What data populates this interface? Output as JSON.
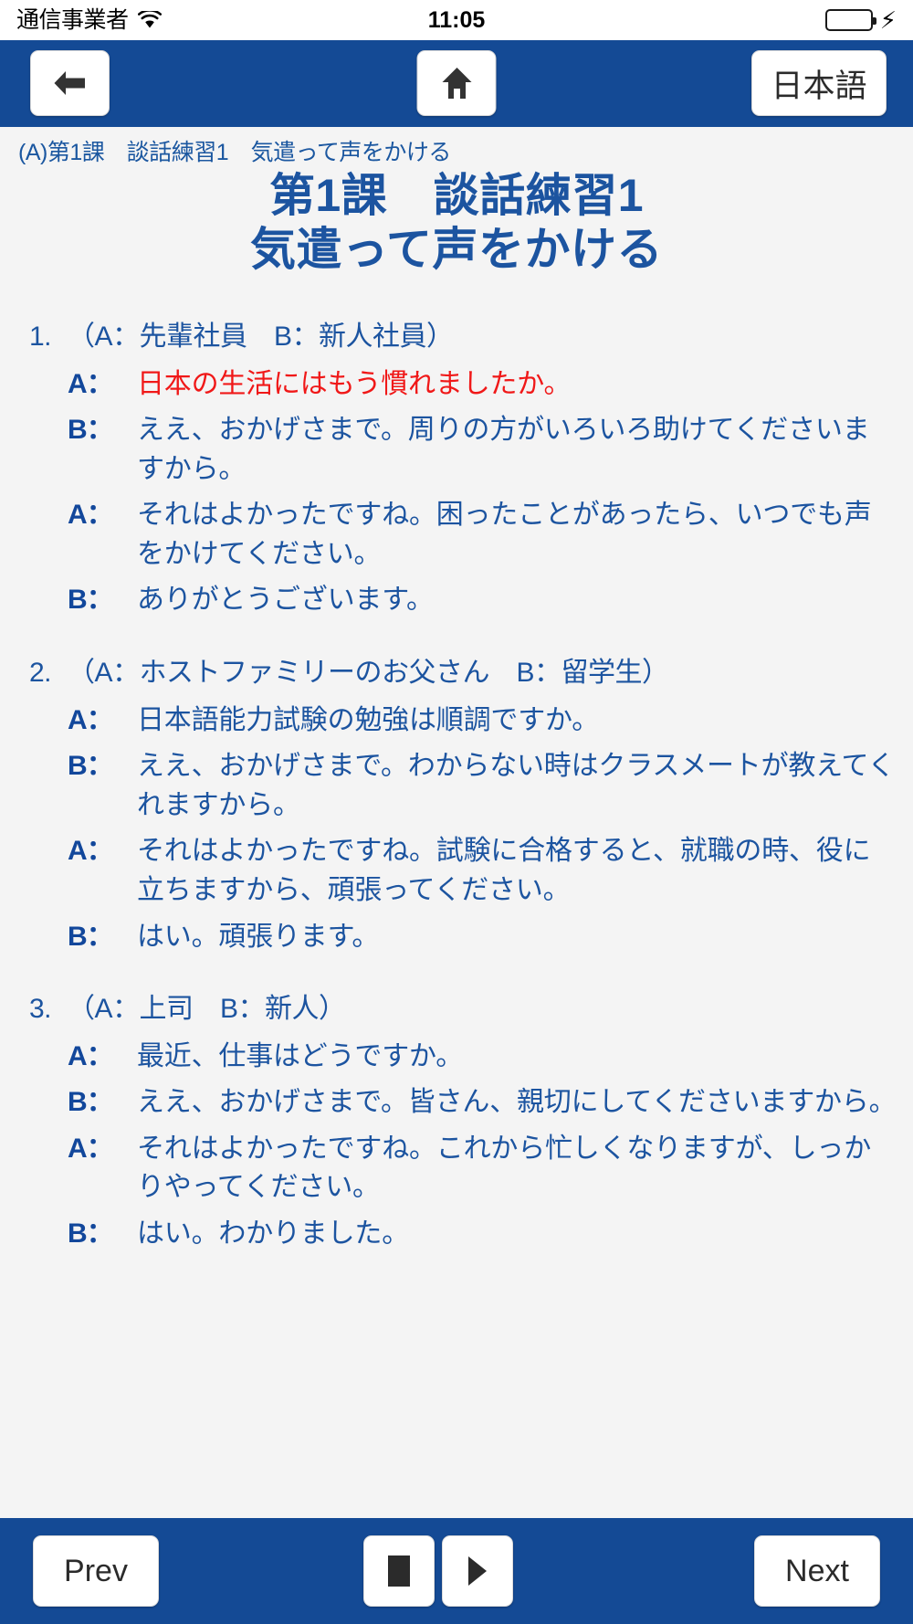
{
  "status_bar": {
    "carrier": "通信事業者",
    "wifi_icon": "wifi-icon",
    "time": "11:05",
    "battery_icon": "battery-icon",
    "battery_charging_icon": "lightning-bolt-icon",
    "battery_color": "#4cd964"
  },
  "navbar": {
    "background_color": "#144A95",
    "back_icon": "arrow-left-icon",
    "home_icon": "home-icon",
    "language_label": "日本語"
  },
  "header": {
    "breadcrumb": "(A)第1課　談話練習1　気遣って声をかける",
    "title_line1": "第1課　談話練習1",
    "title_line2": "気遣って声をかける",
    "title_color": "#1C54A0"
  },
  "theme": {
    "text_blue": "#1C54A0",
    "speaker_blue": "#12479B",
    "highlight_red": "#F01818",
    "page_background": "#f4f4f4"
  },
  "dialogues": [
    {
      "number": "1.",
      "roles": "（A：先輩社員　B：新人社員）",
      "lines": [
        {
          "speaker": "A：",
          "text": "日本の生活にはもう慣れましたか。",
          "highlight": true
        },
        {
          "speaker": "B：",
          "text": "ええ、おかげさまで。周りの方がいろいろ助けてくださいますから。",
          "highlight": false
        },
        {
          "speaker": "A：",
          "text": "それはよかったですね。困ったことがあったら、いつでも声をかけてください。",
          "highlight": false
        },
        {
          "speaker": "B：",
          "text": "ありがとうございます。",
          "highlight": false
        }
      ]
    },
    {
      "number": "2.",
      "roles": "（A：ホストファミリーのお父さん　B：留学生）",
      "lines": [
        {
          "speaker": "A：",
          "text": "日本語能力試験の勉強は順調ですか。",
          "highlight": false
        },
        {
          "speaker": "B：",
          "text": "ええ、おかげさまで。わからない時はクラスメートが教えてくれますから。",
          "highlight": false
        },
        {
          "speaker": "A：",
          "text": "それはよかったですね。試験に合格すると、就職の時、役に立ちますから、頑張ってください。",
          "highlight": false
        },
        {
          "speaker": "B：",
          "text": "はい。頑張ります。",
          "highlight": false
        }
      ]
    },
    {
      "number": "3.",
      "roles": "（A：上司　B：新人）",
      "lines": [
        {
          "speaker": "A：",
          "text": "最近、仕事はどうですか。",
          "highlight": false
        },
        {
          "speaker": "B：",
          "text": "ええ、おかげさまで。皆さん、親切にしてくださいますから。",
          "highlight": false
        },
        {
          "speaker": "A：",
          "text": "それはよかったですね。これから忙しくなりますが、しっかりやってください。",
          "highlight": false
        },
        {
          "speaker": "B：",
          "text": "はい。わかりました。",
          "highlight": false
        }
      ]
    }
  ],
  "toolbar": {
    "background_color": "#144A95",
    "prev_label": "Prev",
    "next_label": "Next",
    "stop_icon": "stop-icon",
    "play_icon": "play-icon"
  }
}
